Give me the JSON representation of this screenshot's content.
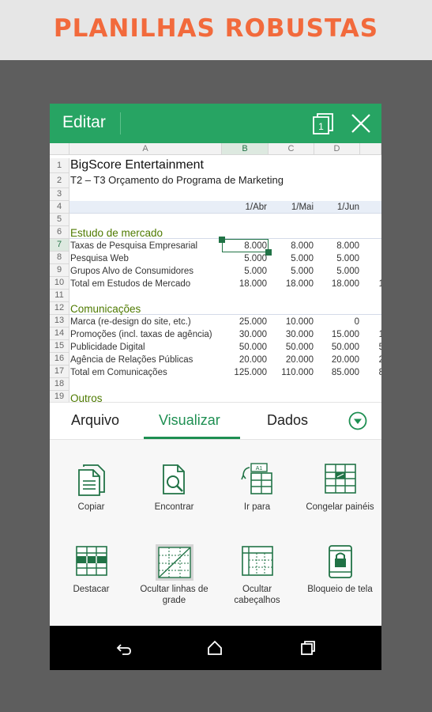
{
  "banner": {
    "title": "PLANILHAS ROBUSTAS"
  },
  "appbar": {
    "title": "Editar",
    "page_count": "1"
  },
  "sheet": {
    "columns": [
      "A",
      "B",
      "C",
      "D"
    ],
    "rows": [
      "1",
      "2",
      "3",
      "4",
      "5",
      "6",
      "7",
      "8",
      "9",
      "10",
      "11",
      "12",
      "13",
      "14",
      "15",
      "16",
      "17",
      "18",
      "19"
    ],
    "title": "BigScore Entertainment",
    "subtitle": "T2 – T3 Orçamento do Programa de Marketing",
    "months": [
      "1/Abr",
      "1/Mai",
      "1/Jun"
    ],
    "section1": "Estudo de mercado",
    "section2": "Comunicações",
    "section3": "Outros",
    "data_rows": [
      {
        "label": "Taxas de Pesquisa Empresarial",
        "b": "8.000",
        "c": "8.000",
        "d": "8.000",
        "e": ""
      },
      {
        "label": "Pesquisa Web",
        "b": "5.000",
        "c": "5.000",
        "d": "5.000",
        "e": ""
      },
      {
        "label": "Grupos Alvo de Consumidores",
        "b": "5.000",
        "c": "5.000",
        "d": "5.000",
        "e": ""
      },
      {
        "label": "Total em Estudos de Mercado",
        "b": "18.000",
        "c": "18.000",
        "d": "18.000",
        "e": "1"
      },
      {
        "label": "Marca (re-design do site, etc.)",
        "b": "25.000",
        "c": "10.000",
        "d": "0",
        "e": ""
      },
      {
        "label": "Promoções (incl. taxas de agência)",
        "b": "30.000",
        "c": "30.000",
        "d": "15.000",
        "e": "1"
      },
      {
        "label": "Publicidade Digital",
        "b": "50.000",
        "c": "50.000",
        "d": "50.000",
        "e": "5"
      },
      {
        "label": "Agência de Relações Públicas",
        "b": "20.000",
        "c": "20.000",
        "d": "20.000",
        "e": "2"
      },
      {
        "label": "Total em Comunicações",
        "b": "125.000",
        "c": "110.000",
        "d": "85.000",
        "e": "8"
      }
    ]
  },
  "tabs": {
    "arquivo": "Arquivo",
    "visualizar": "Visualizar",
    "dados": "Dados"
  },
  "tools": {
    "copiar": "Copiar",
    "encontrar": "Encontrar",
    "ir_para": "Ir para",
    "congelar": "Congelar painéis",
    "destacar": "Destacar",
    "ocultar_linhas_1": "Ocultar linhas de",
    "ocultar_linhas_2": "grade",
    "ocultar_cab_1": "Ocultar",
    "ocultar_cab_2": "cabeçalhos",
    "bloqueio": "Bloqueio de tela",
    "goto_cell_ref": "A1"
  },
  "colors": {
    "accent": "#27a463",
    "banner_text": "#f26a3c",
    "section_text": "#4e7a00"
  }
}
